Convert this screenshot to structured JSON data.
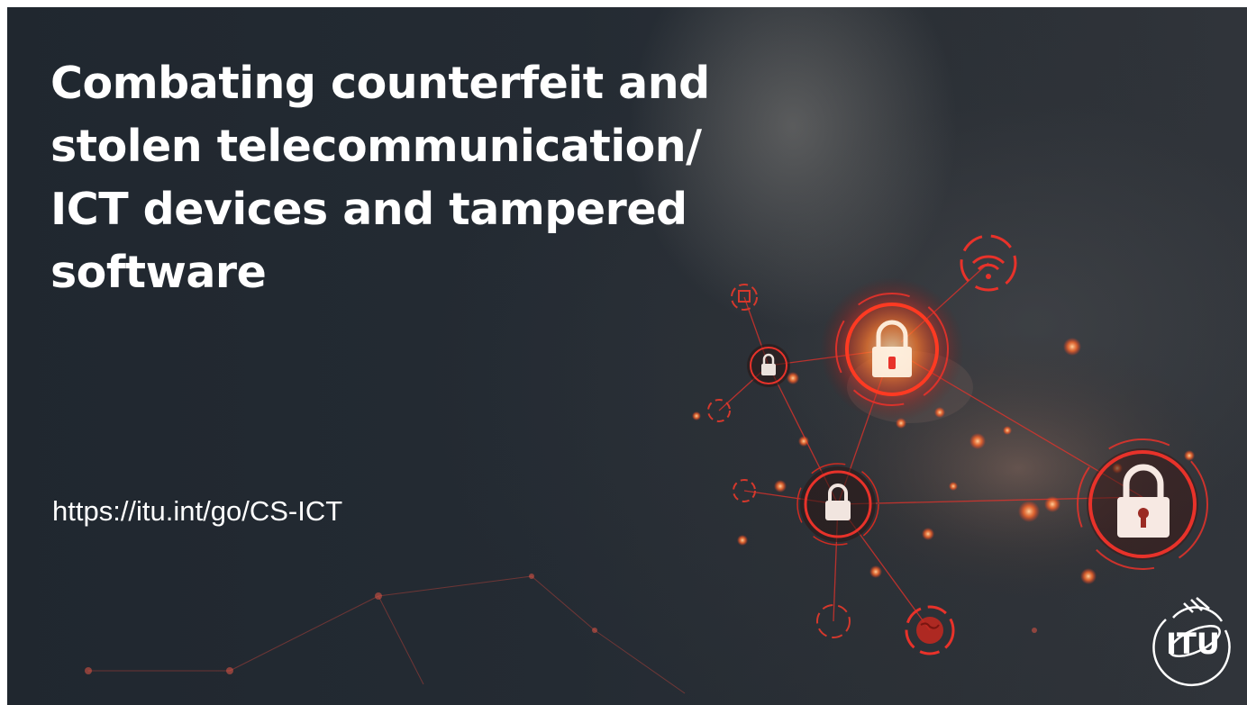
{
  "slide": {
    "title_lines": [
      "Combating counterfeit and",
      "stolen telecommunication/",
      "ICT devices and tampered",
      "software"
    ],
    "url": "https://itu.int/go/CS-ICT",
    "logo_text": "ITU"
  },
  "colors": {
    "background": "#22292f",
    "accent_red": "#e8322a",
    "glow_orange": "#ff8a3c",
    "text": "#ffffff"
  },
  "icons": [
    "padlock-icon",
    "wifi-icon",
    "network-node-icon",
    "globe-icon",
    "itu-logo"
  ]
}
